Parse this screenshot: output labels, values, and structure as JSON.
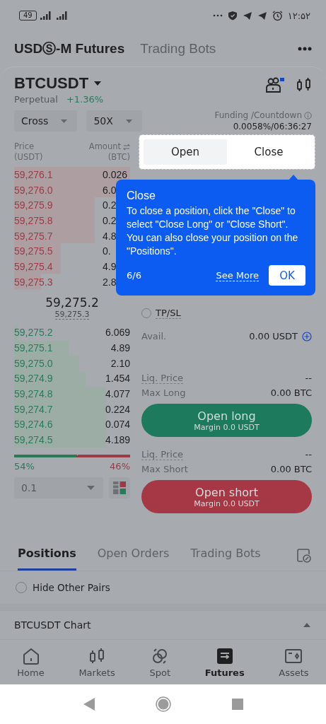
{
  "status_bar": {
    "battery": "49",
    "time": "۱۲:۵۲"
  },
  "header": {
    "tabs": [
      {
        "label": "USDⓈ-M Futures",
        "selected": true
      },
      {
        "label": "Trading Bots",
        "selected": false
      }
    ]
  },
  "instrument": {
    "symbol": "BTCUSDT",
    "type": "Perpetual",
    "change": "+1.36%"
  },
  "controls": {
    "margin_mode": "Cross",
    "leverage": "50X",
    "funding_label": "Funding /Countdown",
    "funding_value": "0.0058%/06:36:27"
  },
  "order_book": {
    "price_label": "Price",
    "price_unit": "(USDT)",
    "amount_label": "Amount",
    "amount_unit": "(BTC)",
    "asks": [
      {
        "price": "59,276.1",
        "amount": "0.026"
      },
      {
        "price": "59,276.0",
        "amount": "6.0"
      },
      {
        "price": "59,275.9",
        "amount": "0.2"
      },
      {
        "price": "59,275.8",
        "amount": "0.2"
      },
      {
        "price": "59,275.7",
        "amount": "4.8"
      },
      {
        "price": "59,275.5",
        "amount": "0."
      },
      {
        "price": "59,275.4",
        "amount": "4.9"
      },
      {
        "price": "59,275.3",
        "amount": "2.8"
      }
    ],
    "last_price": "59,275.2",
    "mark_price": "59,275.3",
    "bids": [
      {
        "price": "59,275.2",
        "amount": "6.069"
      },
      {
        "price": "59,275.1",
        "amount": "4.89"
      },
      {
        "price": "59,275.0",
        "amount": "2.10"
      },
      {
        "price": "59,274.9",
        "amount": "1.454"
      },
      {
        "price": "59,274.8",
        "amount": "4.077"
      },
      {
        "price": "59,274.7",
        "amount": "0.224"
      },
      {
        "price": "59,274.6",
        "amount": "0.074"
      },
      {
        "price": "59,274.5",
        "amount": "4.189"
      }
    ],
    "ratio": {
      "level": 0.54,
      "buy": "54%",
      "sell": "46%"
    },
    "precision": "0.1"
  },
  "order_mode": [
    {
      "label": "Open",
      "selected": true
    },
    {
      "label": "Close",
      "selected": false
    }
  ],
  "trade": {
    "tpsl": {
      "label": "TP/SL",
      "checked": false
    },
    "avail_label": "Avail.",
    "avail_value": "0.00 USDT",
    "sides": [
      {
        "kind": "long",
        "liq_label": "Liq. Price",
        "liq_value": "--",
        "max_label": "Max Long",
        "max_value": "0.00 BTC",
        "button": "Open long",
        "margin": "Margin 0.0 USDT"
      },
      {
        "kind": "short",
        "liq_label": "Liq. Price",
        "liq_value": "--",
        "max_label": "Max Short",
        "max_value": "0.00 BTC",
        "button": "Open short",
        "margin": "Margin 0.0 USDT"
      }
    ]
  },
  "tooltip": {
    "title": "Close",
    "body": "To close a position, click the \"Close\" to select \"Close Long\" or \"Close Short\". You can also close your position on the \"Positions\".",
    "step": "6/6",
    "link": "See More",
    "button": "OK"
  },
  "position_tabs": [
    {
      "label": "Positions",
      "selected": true
    },
    {
      "label": "Open Orders",
      "selected": false
    },
    {
      "label": "Trading Bots",
      "selected": false
    }
  ],
  "hide_other_pairs": {
    "label": "Hide Other Pairs",
    "checked": false
  },
  "chart_section": {
    "title": "BTCUSDT Chart"
  },
  "nav": [
    {
      "kind": "home",
      "label": "Home",
      "selected": false
    },
    {
      "kind": "markets",
      "label": "Markets",
      "selected": false
    },
    {
      "kind": "spot",
      "label": "Spot",
      "selected": false
    },
    {
      "kind": "futures",
      "label": "Futures",
      "selected": true
    },
    {
      "kind": "assets",
      "label": "Assets",
      "selected": false
    }
  ]
}
